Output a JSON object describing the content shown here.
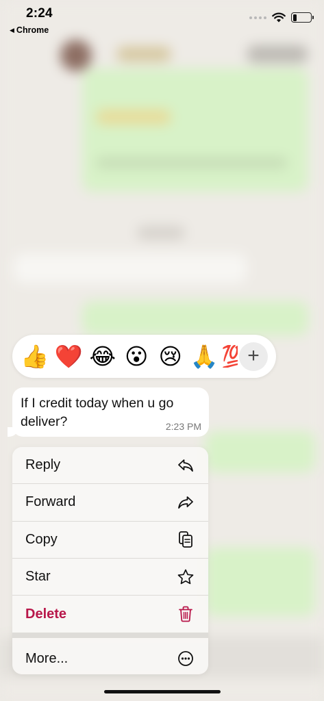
{
  "status_bar": {
    "time": "2:24",
    "back_label": "Chrome",
    "back_arrow": "◀"
  },
  "reactions": {
    "emojis": [
      "👍",
      "❤️",
      "😂",
      "😮",
      "😢",
      "🙏",
      "💯"
    ],
    "add_symbol": "+"
  },
  "message": {
    "text": "If I credit today when u go deliver?",
    "time": "2:23 PM"
  },
  "menu": {
    "items": [
      {
        "label": "Reply",
        "icon": "reply-icon"
      },
      {
        "label": "Forward",
        "icon": "forward-icon"
      },
      {
        "label": "Copy",
        "icon": "copy-icon"
      },
      {
        "label": "Star",
        "icon": "star-icon"
      },
      {
        "label": "Delete",
        "icon": "trash-icon"
      },
      {
        "label": "More...",
        "icon": "more-icon"
      }
    ],
    "delete_color": "#b8174a"
  }
}
